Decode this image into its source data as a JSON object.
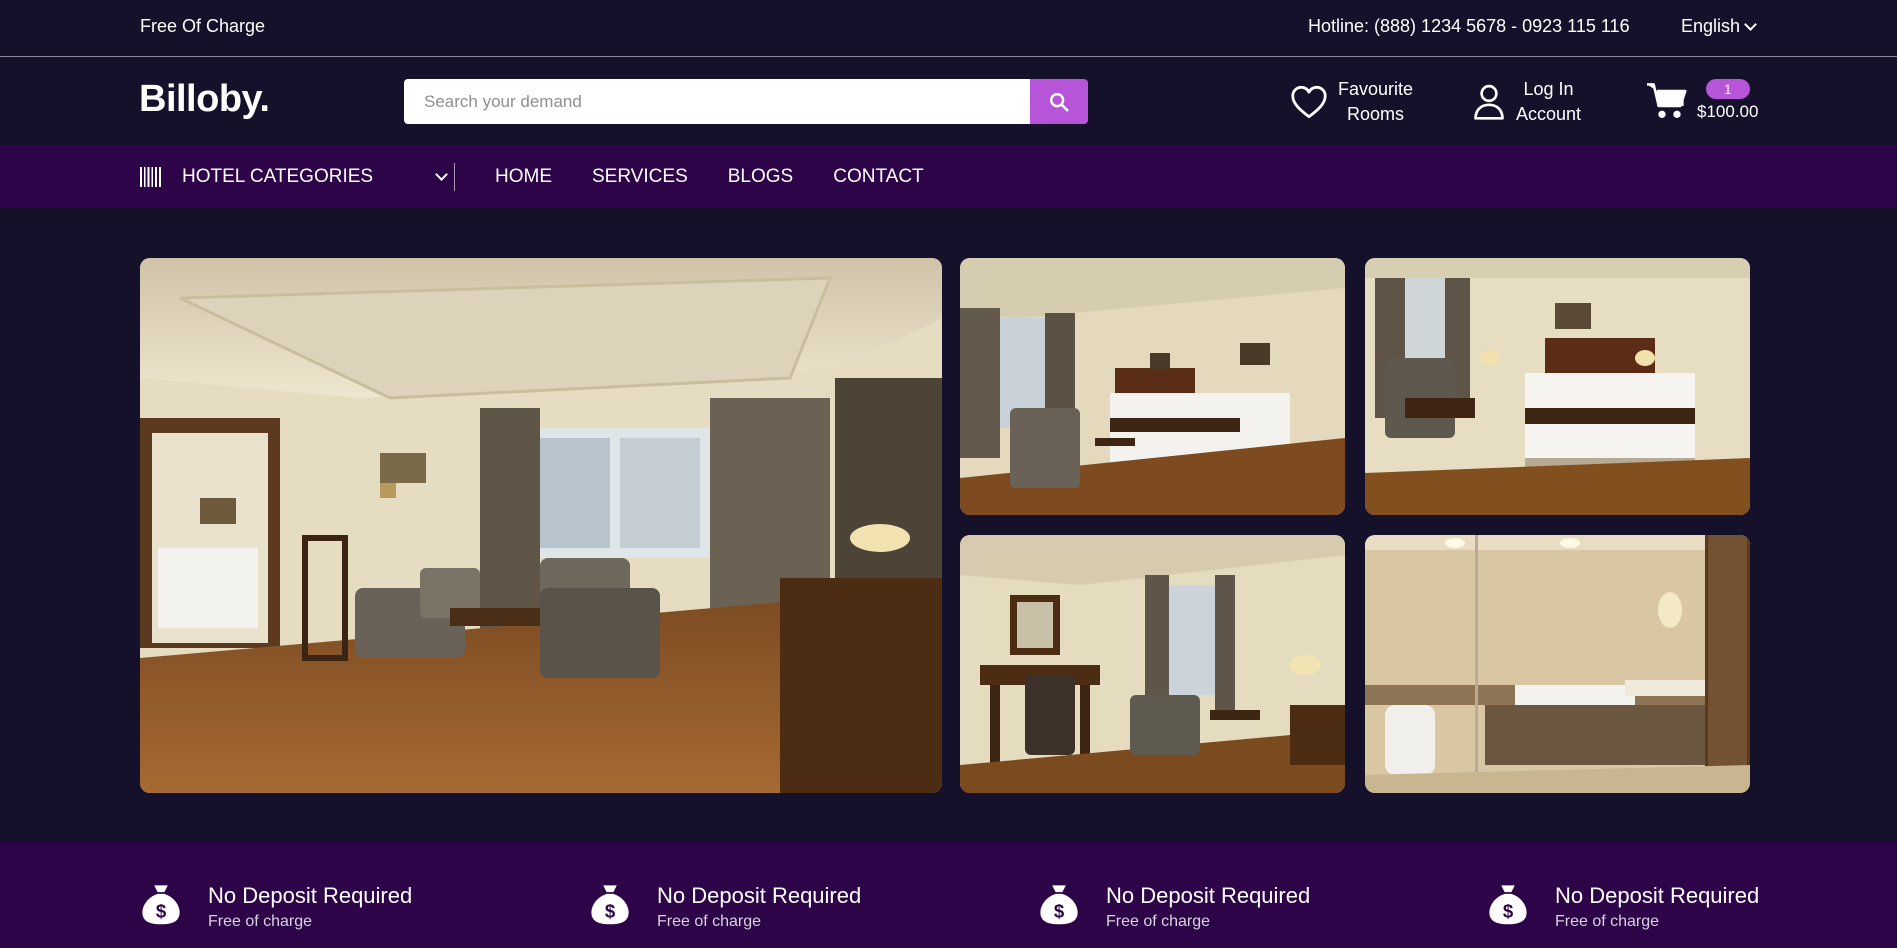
{
  "topbar": {
    "promo": "Free Of Charge",
    "hotline": "Hotline: (888) 1234 5678 - 0923 115 116",
    "language": "English"
  },
  "header": {
    "logo": "Billoby.",
    "search_placeholder": "Search your demand",
    "favourite_line1": "Favourite",
    "favourite_line2": "Rooms",
    "login_line1": "Log In",
    "login_line2": "Account",
    "cart_count": "1",
    "cart_total": "$100.00"
  },
  "nav": {
    "categories_label": "HOTEL CATEGORIES",
    "links": [
      "HOME",
      "SERVICES",
      "BLOGS",
      "CONTACT"
    ]
  },
  "gallery": {
    "photos": [
      "living-room",
      "bedroom-1",
      "bedroom-2",
      "bedroom-3",
      "bathroom"
    ]
  },
  "features": [
    {
      "title": "No Deposit Required",
      "subtitle": "Free of charge"
    },
    {
      "title": "No Deposit Required",
      "subtitle": "Free of charge"
    },
    {
      "title": "No Deposit Required",
      "subtitle": "Free of charge"
    },
    {
      "title": "No Deposit Required",
      "subtitle": "Free of charge"
    }
  ],
  "colors": {
    "background": "#16112b",
    "nav_background": "#2e0449",
    "accent": "#b755d9"
  }
}
